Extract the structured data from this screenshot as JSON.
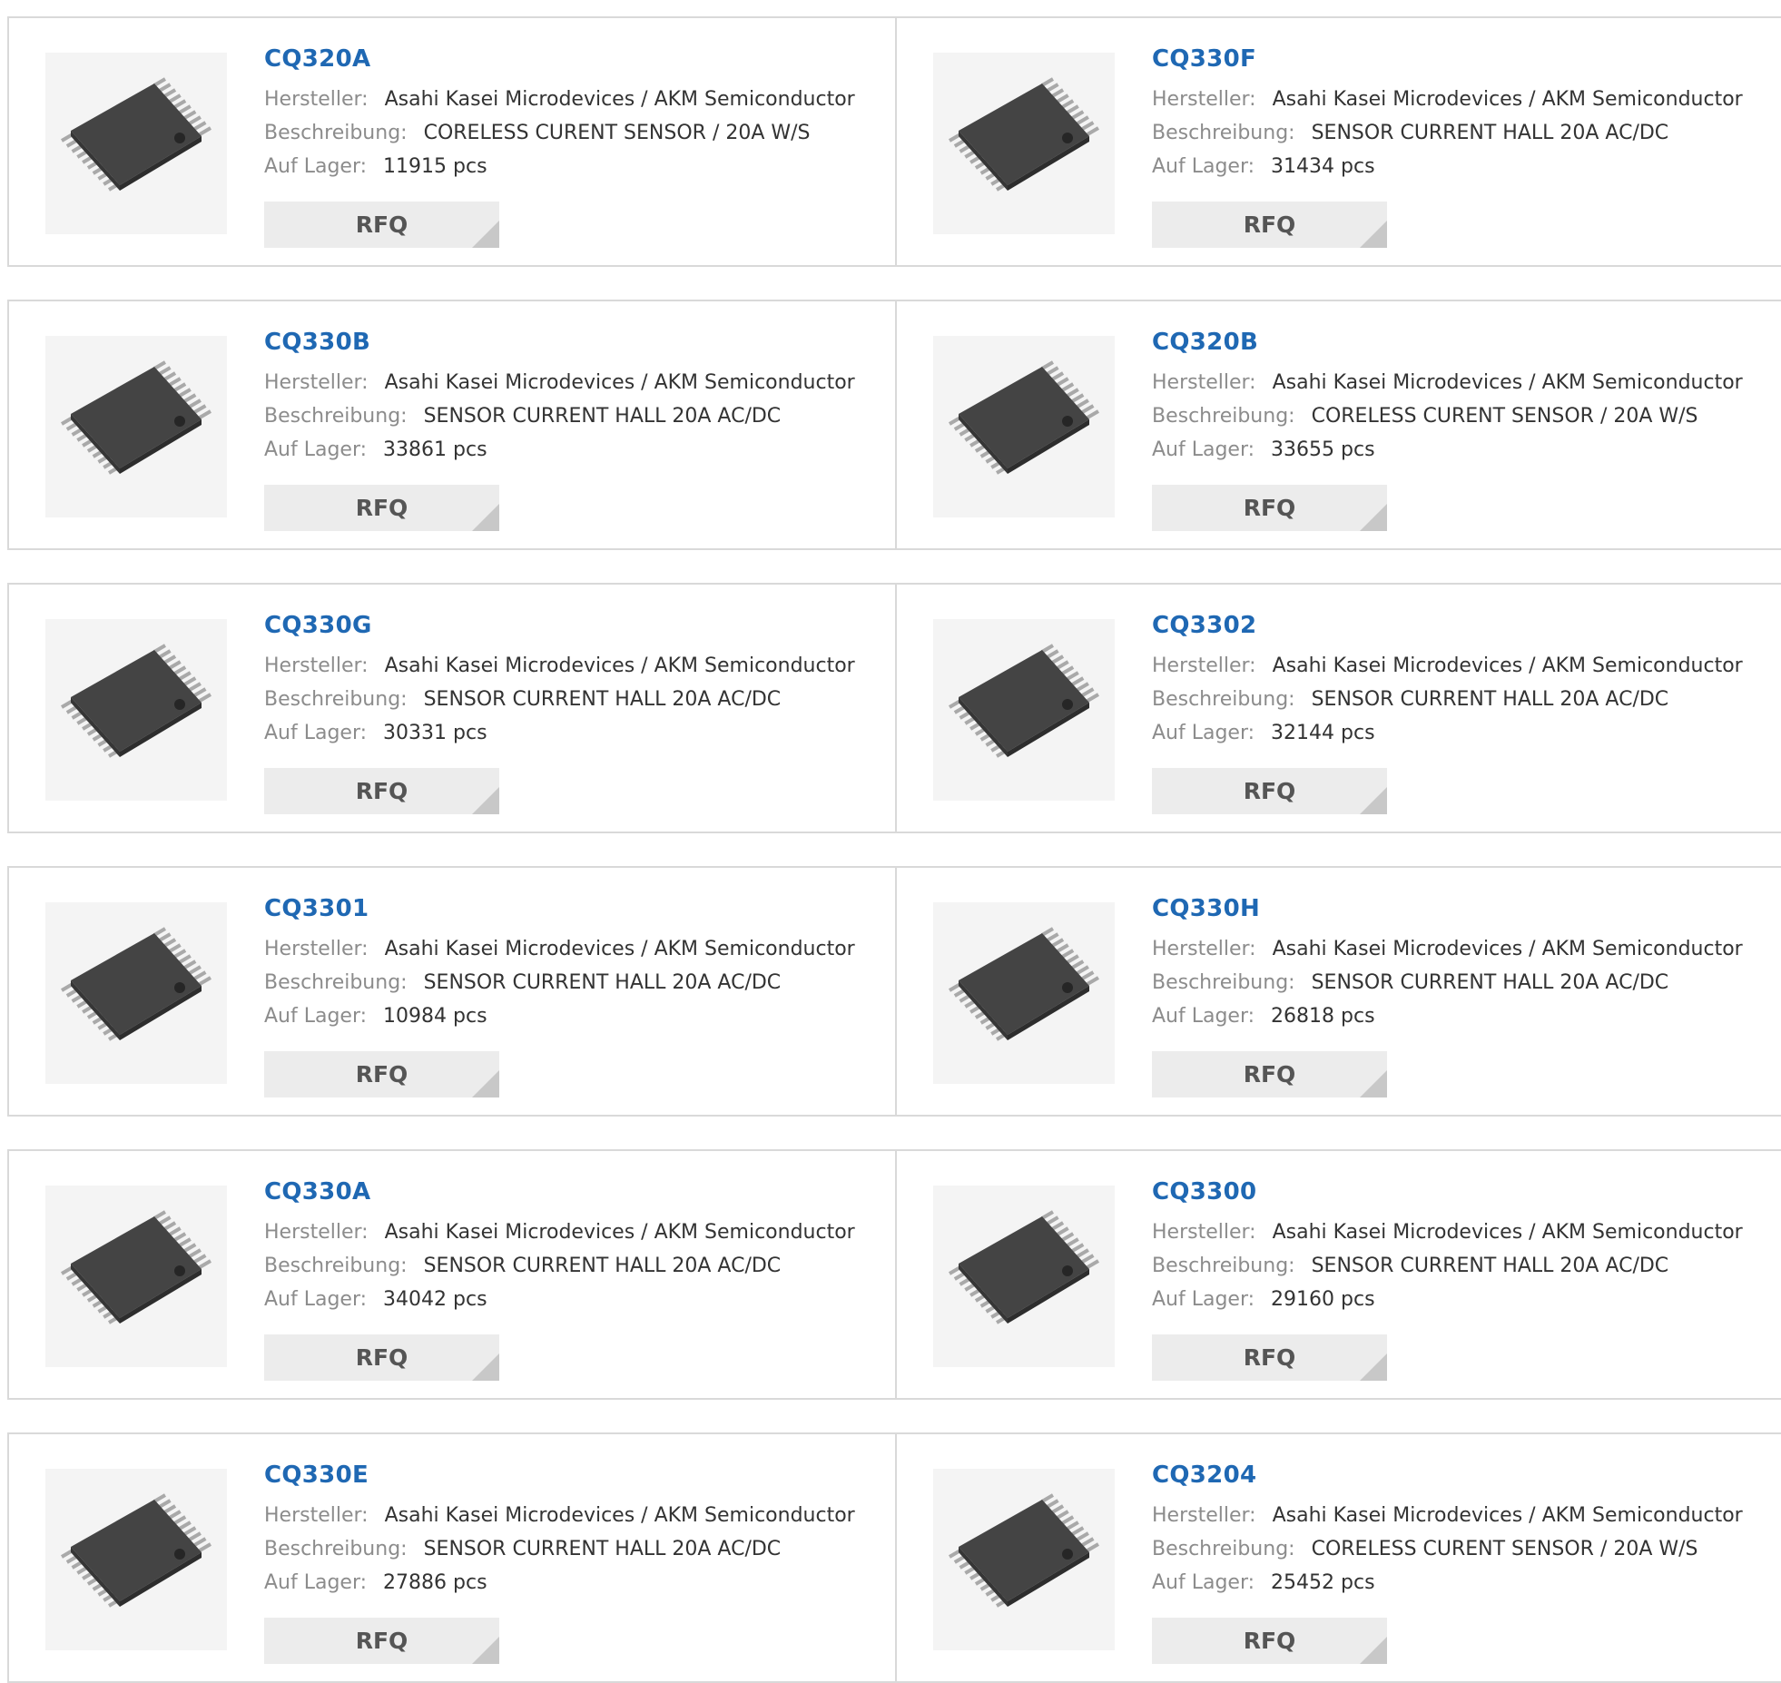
{
  "labels": {
    "manufacturer": "Hersteller:",
    "description": "Beschreibung:",
    "stock": "Auf Lager:",
    "rfq": "RFQ"
  },
  "products": [
    {
      "part": "CQ320A",
      "manufacturer": "Asahi Kasei Microdevices / AKM Semiconductor",
      "description": "CORELESS CURENT SENSOR / 20A W/S",
      "stock": "11915 pcs"
    },
    {
      "part": "CQ330F",
      "manufacturer": "Asahi Kasei Microdevices / AKM Semiconductor",
      "description": "SENSOR CURRENT HALL 20A AC/DC",
      "stock": "31434 pcs"
    },
    {
      "part": "CQ330B",
      "manufacturer": "Asahi Kasei Microdevices / AKM Semiconductor",
      "description": "SENSOR CURRENT HALL 20A AC/DC",
      "stock": "33861 pcs"
    },
    {
      "part": "CQ320B",
      "manufacturer": "Asahi Kasei Microdevices / AKM Semiconductor",
      "description": "CORELESS CURENT SENSOR / 20A W/S",
      "stock": "33655 pcs"
    },
    {
      "part": "CQ330G",
      "manufacturer": "Asahi Kasei Microdevices / AKM Semiconductor",
      "description": "SENSOR CURRENT HALL 20A AC/DC",
      "stock": "30331 pcs"
    },
    {
      "part": "CQ3302",
      "manufacturer": "Asahi Kasei Microdevices / AKM Semiconductor",
      "description": "SENSOR CURRENT HALL 20A AC/DC",
      "stock": "32144 pcs"
    },
    {
      "part": "CQ3301",
      "manufacturer": "Asahi Kasei Microdevices / AKM Semiconductor",
      "description": "SENSOR CURRENT HALL 20A AC/DC",
      "stock": "10984 pcs"
    },
    {
      "part": "CQ330H",
      "manufacturer": "Asahi Kasei Microdevices / AKM Semiconductor",
      "description": "SENSOR CURRENT HALL 20A AC/DC",
      "stock": "26818 pcs"
    },
    {
      "part": "CQ330A",
      "manufacturer": "Asahi Kasei Microdevices / AKM Semiconductor",
      "description": "SENSOR CURRENT HALL 20A AC/DC",
      "stock": "34042 pcs"
    },
    {
      "part": "CQ3300",
      "manufacturer": "Asahi Kasei Microdevices / AKM Semiconductor",
      "description": "SENSOR CURRENT HALL 20A AC/DC",
      "stock": "29160 pcs"
    },
    {
      "part": "CQ330E",
      "manufacturer": "Asahi Kasei Microdevices / AKM Semiconductor",
      "description": "SENSOR CURRENT HALL 20A AC/DC",
      "stock": "27886 pcs"
    },
    {
      "part": "CQ3204",
      "manufacturer": "Asahi Kasei Microdevices / AKM Semiconductor",
      "description": "CORELESS CURENT SENSOR / 20A W/S",
      "stock": "25452 pcs"
    }
  ]
}
